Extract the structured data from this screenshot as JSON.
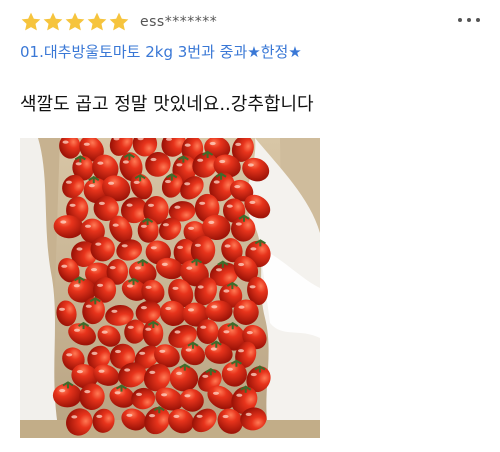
{
  "review": {
    "rating": 5,
    "rating_max": 5,
    "author": "ess*******",
    "option_text": "01.대추방울토마토 2kg  3번과 중과★한정★",
    "body": "색깔도 곱고 정말 맛있네요..강추합니다",
    "photo_icon": "cherry-tomatoes-in-box-photo"
  },
  "colors": {
    "star": "#f6c43d",
    "option_link": "#3a78d6",
    "author": "#555555"
  }
}
